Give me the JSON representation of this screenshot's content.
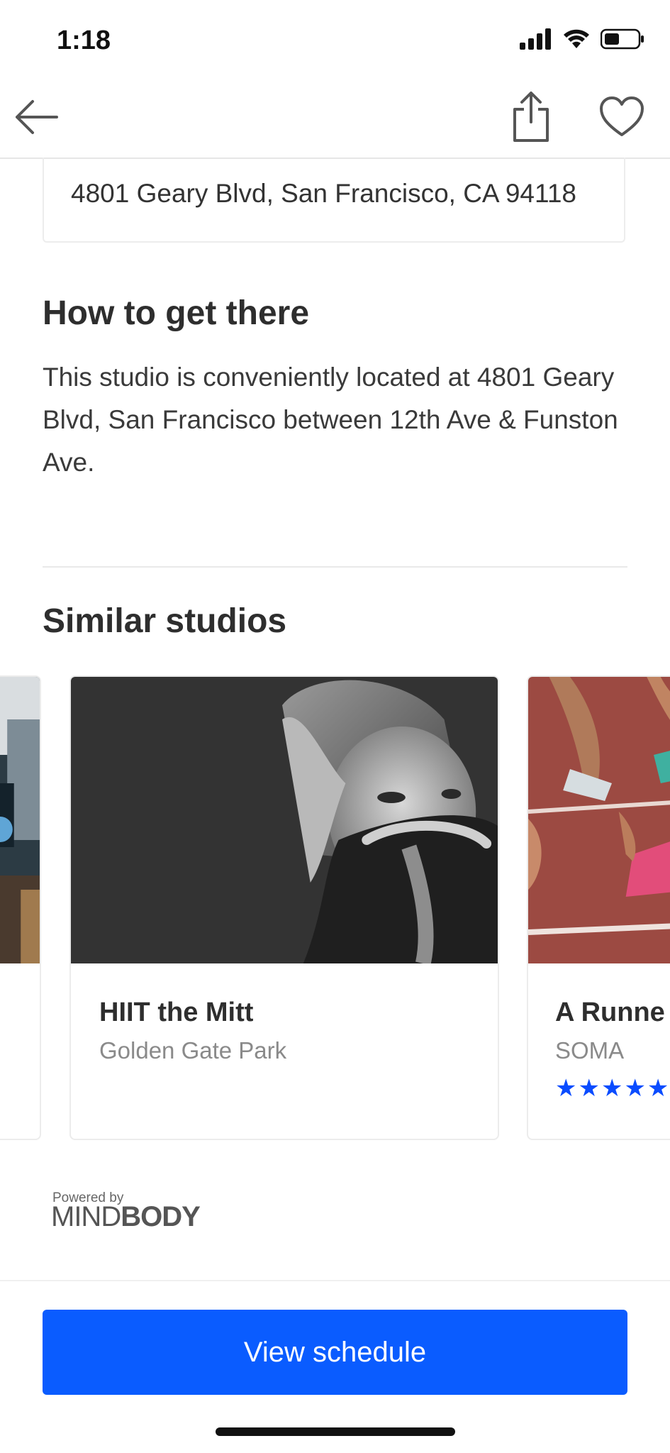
{
  "status_bar": {
    "time": "1:18"
  },
  "address": {
    "text": "4801 Geary Blvd, San Francisco, CA 94118"
  },
  "how_to_get_there": {
    "title": "How to get there",
    "body": "This studio is conveniently located at 4801 Geary Blvd, San Francisco between 12th Ave & Funston Ave."
  },
  "similar": {
    "title": "Similar studios",
    "cards": [
      {
        "name": "HIIT the Mitt",
        "area": "Golden Gate Park"
      },
      {
        "name": "A Runne",
        "area": "SOMA",
        "stars": "★★★★★"
      }
    ]
  },
  "powered_by": {
    "small": "Powered by",
    "logo_light": "MIND",
    "logo_bold": "BODY"
  },
  "cta": {
    "label": "View schedule"
  },
  "colors": {
    "accent": "#0a5cff",
    "star": "#0a4cff"
  }
}
